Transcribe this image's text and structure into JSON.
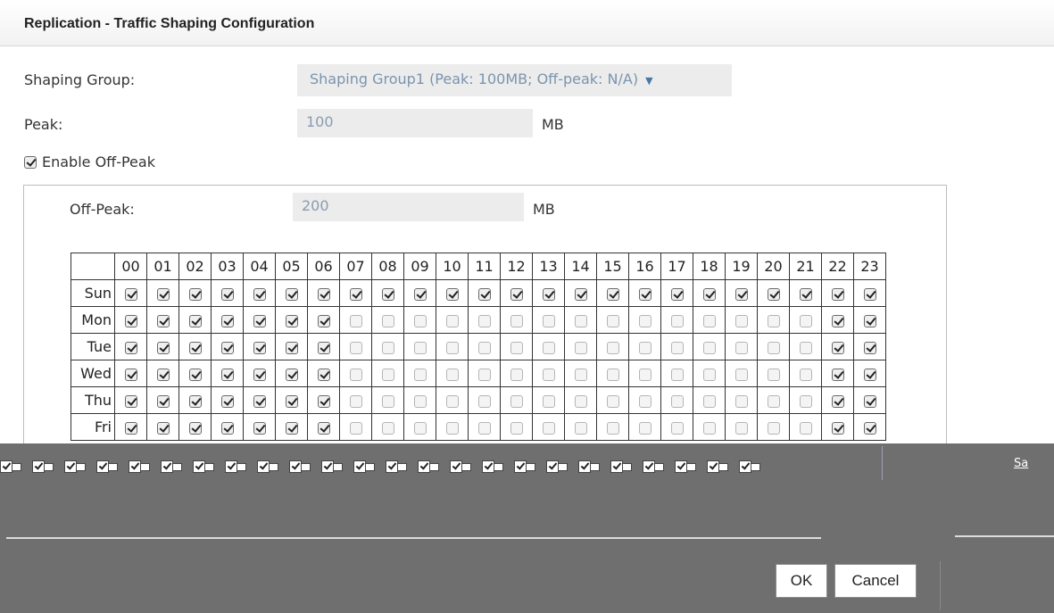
{
  "dialog": {
    "title": "Replication - Traffic Shaping Configuration"
  },
  "form": {
    "shaping_group_label": "Shaping Group:",
    "shaping_group_value": "Shaping Group1 (Peak: 100MB; Off-peak: N/A)",
    "peak_label": "Peak:",
    "peak_value": "100",
    "peak_unit": "MB",
    "enable_offpeak_label": "Enable Off-Peak",
    "enable_offpeak_checked": true,
    "offpeak_label": "Off-Peak:",
    "offpeak_value": "200",
    "offpeak_unit": "MB"
  },
  "schedule": {
    "hours": [
      "00",
      "01",
      "02",
      "03",
      "04",
      "05",
      "06",
      "07",
      "08",
      "09",
      "10",
      "11",
      "12",
      "13",
      "14",
      "15",
      "16",
      "17",
      "18",
      "19",
      "20",
      "21",
      "22",
      "23"
    ],
    "days": [
      {
        "name": "Sun",
        "checked": [
          1,
          1,
          1,
          1,
          1,
          1,
          1,
          1,
          1,
          1,
          1,
          1,
          1,
          1,
          1,
          1,
          1,
          1,
          1,
          1,
          1,
          1,
          1,
          1
        ]
      },
      {
        "name": "Mon",
        "checked": [
          1,
          1,
          1,
          1,
          1,
          1,
          1,
          0,
          0,
          0,
          0,
          0,
          0,
          0,
          0,
          0,
          0,
          0,
          0,
          0,
          0,
          0,
          1,
          1
        ]
      },
      {
        "name": "Tue",
        "checked": [
          1,
          1,
          1,
          1,
          1,
          1,
          1,
          0,
          0,
          0,
          0,
          0,
          0,
          0,
          0,
          0,
          0,
          0,
          0,
          0,
          0,
          0,
          1,
          1
        ]
      },
      {
        "name": "Wed",
        "checked": [
          1,
          1,
          1,
          1,
          1,
          1,
          1,
          0,
          0,
          0,
          0,
          0,
          0,
          0,
          0,
          0,
          0,
          0,
          0,
          0,
          0,
          0,
          1,
          1
        ]
      },
      {
        "name": "Thu",
        "checked": [
          1,
          1,
          1,
          1,
          1,
          1,
          1,
          0,
          0,
          0,
          0,
          0,
          0,
          0,
          0,
          0,
          0,
          0,
          0,
          0,
          0,
          0,
          1,
          1
        ]
      },
      {
        "name": "Fri",
        "checked": [
          1,
          1,
          1,
          1,
          1,
          1,
          1,
          0,
          0,
          0,
          0,
          0,
          0,
          0,
          0,
          0,
          0,
          0,
          0,
          0,
          0,
          0,
          1,
          1
        ]
      }
    ]
  },
  "overlay": {
    "ghost_label": "Sa"
  },
  "buttons": {
    "ok": "OK",
    "cancel": "Cancel"
  }
}
